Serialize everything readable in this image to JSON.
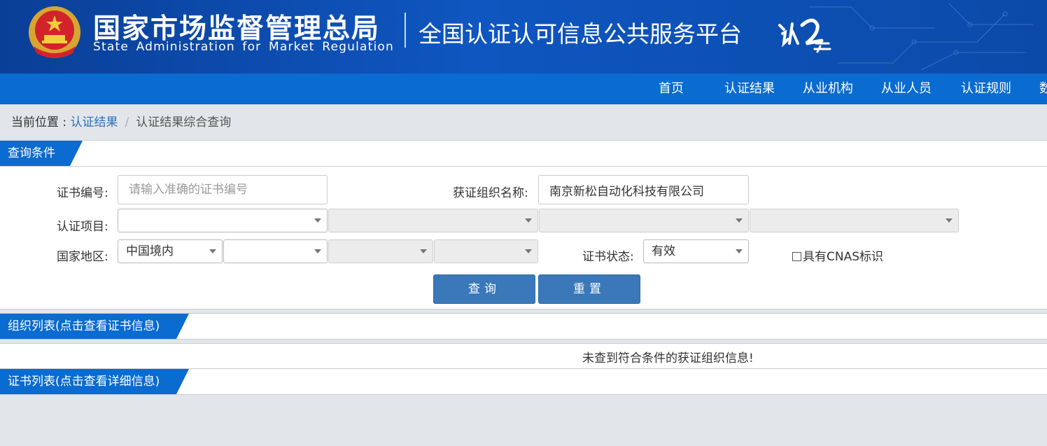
{
  "header": {
    "agency_cn": "国家市场监督管理总局",
    "agency_en": "State Administration  for  Market Regulation",
    "platform_title": "全国认证认可信息公共服务平台",
    "emblem_icon": "national-emblem-icon",
    "logo_icon": "renyun-logo-icon"
  },
  "nav": {
    "items": [
      "首页",
      "认证结果",
      "从业机构",
      "从业人员",
      "认证规则",
      "数"
    ]
  },
  "breadcrumb": {
    "prefix": "当前位置 : ",
    "link": "认证结果",
    "separator": "/",
    "current": "认证结果综合查询"
  },
  "query_panel": {
    "title": "查询条件",
    "cert_no_label": "证书编号:",
    "cert_no_placeholder": "请输入准确的证书编号",
    "cert_no_value": "",
    "org_name_label": "获证组织名称:",
    "org_name_value": "南京新松自动化科技有限公司",
    "project_label": "认证项目:",
    "project_selects": [
      "",
      "",
      "",
      ""
    ],
    "region_label": "国家地区:",
    "region_selects": [
      "中国境内",
      "",
      "",
      ""
    ],
    "status_label": "证书状态:",
    "status_value": "有效",
    "cnas_label": "具有CNAS标识",
    "query_button": "查询",
    "reset_button": "重置"
  },
  "org_panel": {
    "title": "组织列表(点击查看证书信息)",
    "empty_message": "未查到符合条件的获证组织信息!"
  },
  "cert_panel": {
    "title": "证书列表(点击查看详细信息)"
  },
  "colors": {
    "banner": "#0f56c0",
    "nav": "#0a6bd0",
    "tag": "#0a6bd0",
    "button": "#3a78b9",
    "page_bg": "#e2e6ea"
  }
}
